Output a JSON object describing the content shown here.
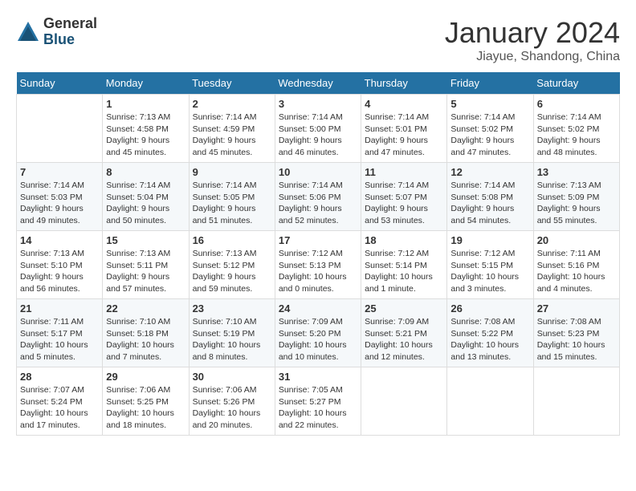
{
  "logo": {
    "general": "General",
    "blue": "Blue"
  },
  "title": "January 2024",
  "subtitle": "Jiayue, Shandong, China",
  "days_of_week": [
    "Sunday",
    "Monday",
    "Tuesday",
    "Wednesday",
    "Thursday",
    "Friday",
    "Saturday"
  ],
  "weeks": [
    [
      {
        "day": "",
        "sunrise": "",
        "sunset": "",
        "daylight": ""
      },
      {
        "day": "1",
        "sunrise": "Sunrise: 7:13 AM",
        "sunset": "Sunset: 4:58 PM",
        "daylight": "Daylight: 9 hours and 45 minutes."
      },
      {
        "day": "2",
        "sunrise": "Sunrise: 7:14 AM",
        "sunset": "Sunset: 4:59 PM",
        "daylight": "Daylight: 9 hours and 45 minutes."
      },
      {
        "day": "3",
        "sunrise": "Sunrise: 7:14 AM",
        "sunset": "Sunset: 5:00 PM",
        "daylight": "Daylight: 9 hours and 46 minutes."
      },
      {
        "day": "4",
        "sunrise": "Sunrise: 7:14 AM",
        "sunset": "Sunset: 5:01 PM",
        "daylight": "Daylight: 9 hours and 47 minutes."
      },
      {
        "day": "5",
        "sunrise": "Sunrise: 7:14 AM",
        "sunset": "Sunset: 5:02 PM",
        "daylight": "Daylight: 9 hours and 47 minutes."
      },
      {
        "day": "6",
        "sunrise": "Sunrise: 7:14 AM",
        "sunset": "Sunset: 5:02 PM",
        "daylight": "Daylight: 9 hours and 48 minutes."
      }
    ],
    [
      {
        "day": "7",
        "sunrise": "Sunrise: 7:14 AM",
        "sunset": "Sunset: 5:03 PM",
        "daylight": "Daylight: 9 hours and 49 minutes."
      },
      {
        "day": "8",
        "sunrise": "Sunrise: 7:14 AM",
        "sunset": "Sunset: 5:04 PM",
        "daylight": "Daylight: 9 hours and 50 minutes."
      },
      {
        "day": "9",
        "sunrise": "Sunrise: 7:14 AM",
        "sunset": "Sunset: 5:05 PM",
        "daylight": "Daylight: 9 hours and 51 minutes."
      },
      {
        "day": "10",
        "sunrise": "Sunrise: 7:14 AM",
        "sunset": "Sunset: 5:06 PM",
        "daylight": "Daylight: 9 hours and 52 minutes."
      },
      {
        "day": "11",
        "sunrise": "Sunrise: 7:14 AM",
        "sunset": "Sunset: 5:07 PM",
        "daylight": "Daylight: 9 hours and 53 minutes."
      },
      {
        "day": "12",
        "sunrise": "Sunrise: 7:14 AM",
        "sunset": "Sunset: 5:08 PM",
        "daylight": "Daylight: 9 hours and 54 minutes."
      },
      {
        "day": "13",
        "sunrise": "Sunrise: 7:13 AM",
        "sunset": "Sunset: 5:09 PM",
        "daylight": "Daylight: 9 hours and 55 minutes."
      }
    ],
    [
      {
        "day": "14",
        "sunrise": "Sunrise: 7:13 AM",
        "sunset": "Sunset: 5:10 PM",
        "daylight": "Daylight: 9 hours and 56 minutes."
      },
      {
        "day": "15",
        "sunrise": "Sunrise: 7:13 AM",
        "sunset": "Sunset: 5:11 PM",
        "daylight": "Daylight: 9 hours and 57 minutes."
      },
      {
        "day": "16",
        "sunrise": "Sunrise: 7:13 AM",
        "sunset": "Sunset: 5:12 PM",
        "daylight": "Daylight: 9 hours and 59 minutes."
      },
      {
        "day": "17",
        "sunrise": "Sunrise: 7:12 AM",
        "sunset": "Sunset: 5:13 PM",
        "daylight": "Daylight: 10 hours and 0 minutes."
      },
      {
        "day": "18",
        "sunrise": "Sunrise: 7:12 AM",
        "sunset": "Sunset: 5:14 PM",
        "daylight": "Daylight: 10 hours and 1 minute."
      },
      {
        "day": "19",
        "sunrise": "Sunrise: 7:12 AM",
        "sunset": "Sunset: 5:15 PM",
        "daylight": "Daylight: 10 hours and 3 minutes."
      },
      {
        "day": "20",
        "sunrise": "Sunrise: 7:11 AM",
        "sunset": "Sunset: 5:16 PM",
        "daylight": "Daylight: 10 hours and 4 minutes."
      }
    ],
    [
      {
        "day": "21",
        "sunrise": "Sunrise: 7:11 AM",
        "sunset": "Sunset: 5:17 PM",
        "daylight": "Daylight: 10 hours and 5 minutes."
      },
      {
        "day": "22",
        "sunrise": "Sunrise: 7:10 AM",
        "sunset": "Sunset: 5:18 PM",
        "daylight": "Daylight: 10 hours and 7 minutes."
      },
      {
        "day": "23",
        "sunrise": "Sunrise: 7:10 AM",
        "sunset": "Sunset: 5:19 PM",
        "daylight": "Daylight: 10 hours and 8 minutes."
      },
      {
        "day": "24",
        "sunrise": "Sunrise: 7:09 AM",
        "sunset": "Sunset: 5:20 PM",
        "daylight": "Daylight: 10 hours and 10 minutes."
      },
      {
        "day": "25",
        "sunrise": "Sunrise: 7:09 AM",
        "sunset": "Sunset: 5:21 PM",
        "daylight": "Daylight: 10 hours and 12 minutes."
      },
      {
        "day": "26",
        "sunrise": "Sunrise: 7:08 AM",
        "sunset": "Sunset: 5:22 PM",
        "daylight": "Daylight: 10 hours and 13 minutes."
      },
      {
        "day": "27",
        "sunrise": "Sunrise: 7:08 AM",
        "sunset": "Sunset: 5:23 PM",
        "daylight": "Daylight: 10 hours and 15 minutes."
      }
    ],
    [
      {
        "day": "28",
        "sunrise": "Sunrise: 7:07 AM",
        "sunset": "Sunset: 5:24 PM",
        "daylight": "Daylight: 10 hours and 17 minutes."
      },
      {
        "day": "29",
        "sunrise": "Sunrise: 7:06 AM",
        "sunset": "Sunset: 5:25 PM",
        "daylight": "Daylight: 10 hours and 18 minutes."
      },
      {
        "day": "30",
        "sunrise": "Sunrise: 7:06 AM",
        "sunset": "Sunset: 5:26 PM",
        "daylight": "Daylight: 10 hours and 20 minutes."
      },
      {
        "day": "31",
        "sunrise": "Sunrise: 7:05 AM",
        "sunset": "Sunset: 5:27 PM",
        "daylight": "Daylight: 10 hours and 22 minutes."
      },
      {
        "day": "",
        "sunrise": "",
        "sunset": "",
        "daylight": ""
      },
      {
        "day": "",
        "sunrise": "",
        "sunset": "",
        "daylight": ""
      },
      {
        "day": "",
        "sunrise": "",
        "sunset": "",
        "daylight": ""
      }
    ]
  ]
}
